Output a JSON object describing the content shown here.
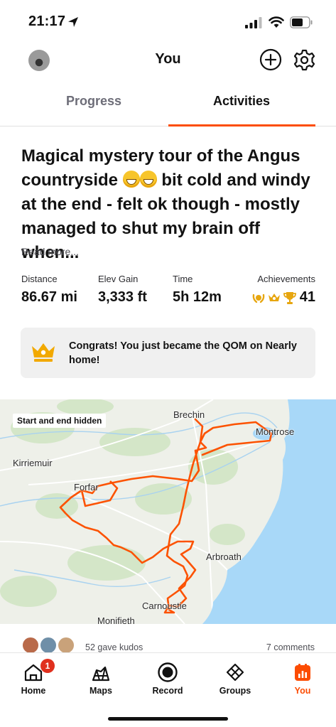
{
  "status_bar": {
    "time": "21:17"
  },
  "header": {
    "title": "You"
  },
  "tabs": [
    {
      "label": "Progress"
    },
    {
      "label": "Activities"
    }
  ],
  "activity": {
    "title": "Magical mystery tour of the Angus countryside",
    "title_rest": "bit cold and windy at the end - felt ok though - mostly managed to shut my brain off when...",
    "read_more": "Read more...",
    "stats": {
      "distance_label": "Distance",
      "distance_value": "86.67 mi",
      "elev_label": "Elev Gain",
      "elev_value": "3,333 ft",
      "time_label": "Time",
      "time_value": "5h 12m",
      "achievements_label": "Achievements",
      "achievements_value": "41"
    },
    "congrats": "Congrats! You just became the QOM on Nearly home!"
  },
  "map": {
    "privacy_label": "Start and end hidden",
    "towns": {
      "brechin": "Brechin",
      "montrose": "Montrose",
      "kirriemuir": "Kirriemuir",
      "forfar": "Forfar",
      "arbroath": "Arbroath",
      "carnoustie": "Carnoustie",
      "monifieth": "Monifieth"
    }
  },
  "social": {
    "kudos": "52 gave kudos",
    "comments": "7 comments"
  },
  "tabbar": {
    "home": "Home",
    "home_badge": "1",
    "maps": "Maps",
    "record": "Record",
    "groups": "Groups",
    "you": "You"
  },
  "colors": {
    "accent": "#fc4c02",
    "route": "#fc5200",
    "water": "#a8d8f8"
  }
}
